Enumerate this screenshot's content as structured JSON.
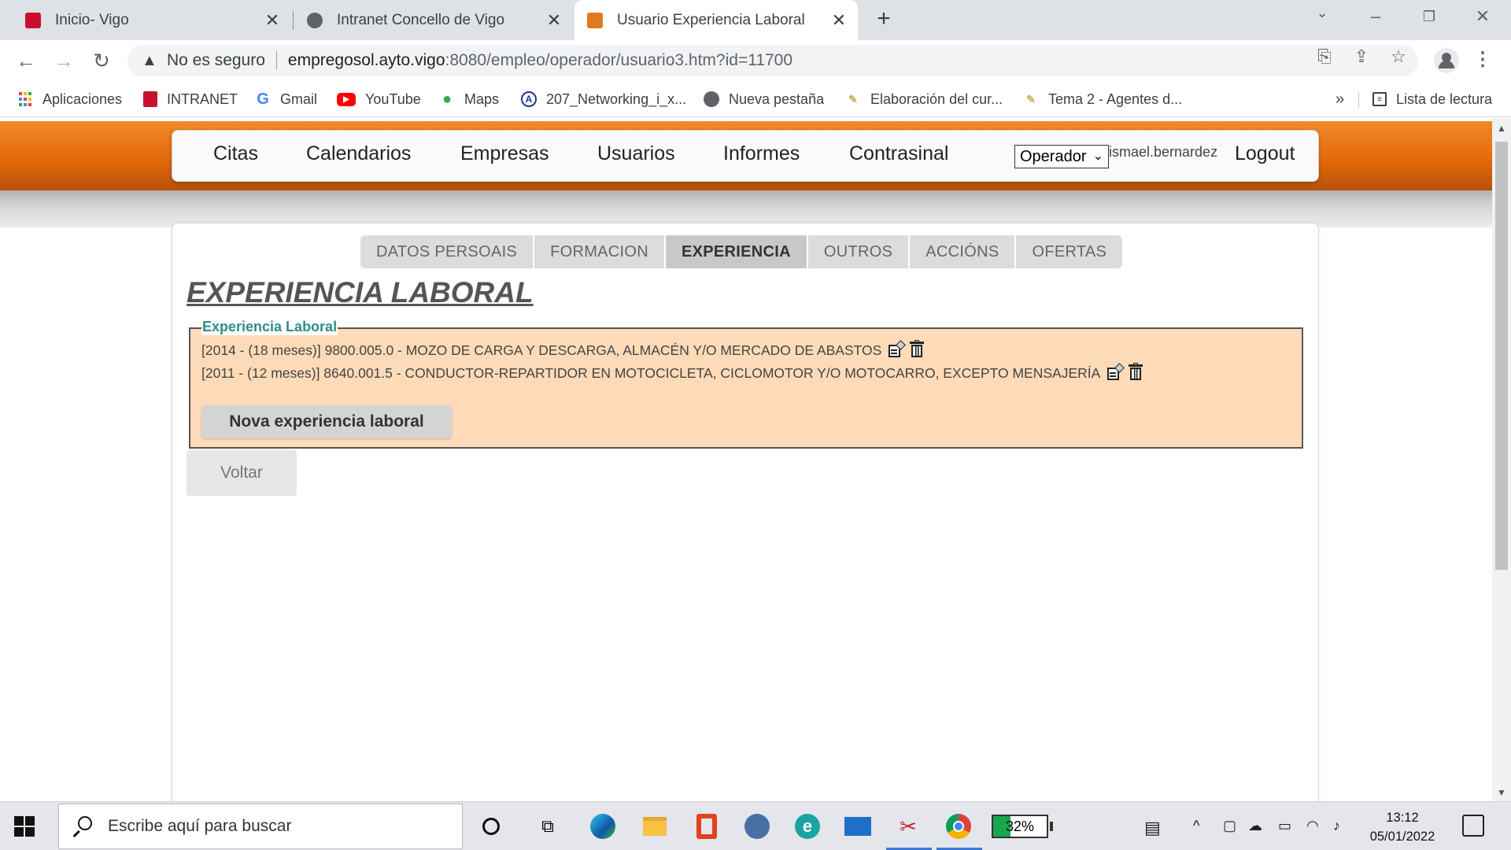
{
  "browser": {
    "tabs": [
      {
        "title": "Inicio- Vigo",
        "favicon_color": "#c8102e"
      },
      {
        "title": "Intranet Concello de Vigo",
        "favicon_color": "#5f6368"
      },
      {
        "title": "Usuario Experiencia Laboral",
        "favicon_color": "#e07a1f"
      }
    ],
    "active_tab": 2,
    "address": {
      "security_label": "No es seguro",
      "host": "empregosol.ayto.vigo",
      "path": ":8080/empleo/operador/usuario3.htm?id=11700"
    },
    "bookmarks": [
      {
        "label": "Aplicaciones",
        "icon": "apps-grid-icon"
      },
      {
        "label": "INTRANET",
        "icon": "vigo-crest-icon"
      },
      {
        "label": "Gmail",
        "icon": "google-icon"
      },
      {
        "label": "YouTube",
        "icon": "youtube-icon"
      },
      {
        "label": "Maps",
        "icon": "maps-pin-icon"
      },
      {
        "label": "207_Networking_i_x...",
        "icon": "alpha-icon"
      },
      {
        "label": "Nueva pestaña",
        "icon": "globe-icon"
      },
      {
        "label": "Elaboración del cur...",
        "icon": "pen-icon"
      },
      {
        "label": "Tema 2 - Agentes d...",
        "icon": "pen-icon"
      }
    ],
    "bookmarks_overflow": "»",
    "reading_list": "Lista de lectura"
  },
  "app": {
    "nav": [
      "Citas",
      "Calendarios",
      "Empresas",
      "Usuarios",
      "Informes",
      "Contrasinal"
    ],
    "role_select": "Operador",
    "username": "ismael.bernardez",
    "logout": "Logout",
    "subtabs": [
      "DATOS PERSOAIS",
      "FORMACION",
      "EXPERIENCIA",
      "OUTROS",
      "ACCIÓNS",
      "OFERTAS"
    ],
    "active_subtab": 2,
    "page_title": "EXPERIENCIA LABORAL",
    "section_legend": "Experiencia Laboral",
    "experiences": [
      {
        "text": "[2014 - (18 meses)] 9800.005.0 - MOZO DE CARGA Y DESCARGA, ALMACÉN Y/O MERCADO DE ABASTOS"
      },
      {
        "text": "[2011 - (12 meses)] 8640.001.5 - CONDUCTOR-REPARTIDOR EN MOTOCICLETA, CICLOMOTOR Y/O MOTOCARRO, EXCEPTO MENSAJERÍA"
      }
    ],
    "new_button": "Nova experiencia laboral",
    "back_button": "Voltar"
  },
  "taskbar": {
    "search_placeholder": "Escribe aquí para buscar",
    "battery_percent": "32%",
    "battery_level": 0.32,
    "time": "13:12",
    "date": "05/01/2022"
  },
  "colors": {
    "orange_band": "#e56a0a",
    "legend_teal": "#2f8c8c",
    "fieldset_bg": "#fedbb8"
  }
}
